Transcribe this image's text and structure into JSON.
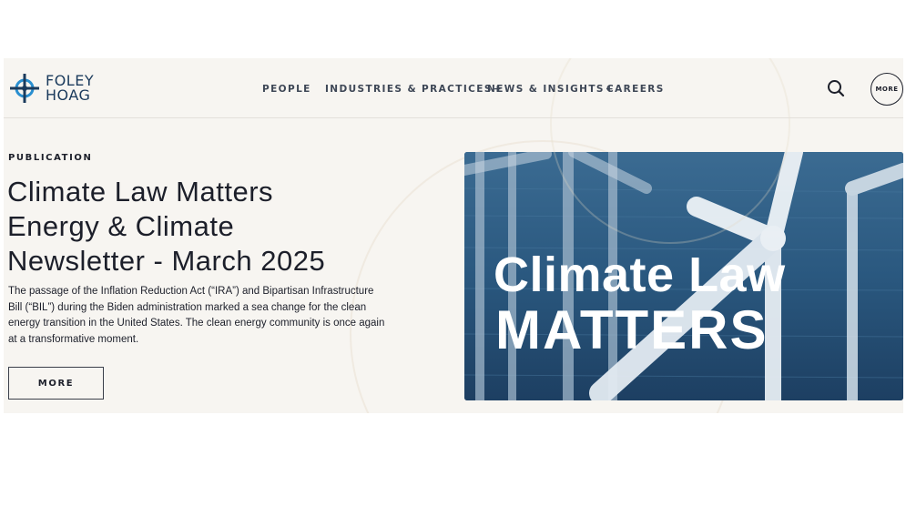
{
  "brand": {
    "line1": "FOLEY",
    "line2": "HOAG"
  },
  "nav": {
    "items": [
      {
        "label": "PEOPLE",
        "plus": ""
      },
      {
        "label": "INDUSTRIES & PRACTICES",
        "plus": "+"
      },
      {
        "label": "NEWS & INSIGHTS",
        "plus": "+"
      },
      {
        "label": "CAREERS",
        "plus": ""
      }
    ],
    "more_label": "MORE",
    "search_icon": "search-icon"
  },
  "article": {
    "eyebrow": "PUBLICATION",
    "title_lines": [
      "Climate Law Matters",
      "Energy & Climate",
      "Newsletter - March 2025"
    ],
    "summary": "The passage of the Inflation Reduction Act (“IRA”) and Bipartisan Infrastructure Bill (“BIL”) during the Biden administration marked a sea change for the clean energy transition in the United States. The clean energy community is once again at a transformative moment.",
    "cta_label": "MORE"
  },
  "hero": {
    "line1": "Climate Law",
    "line2": "MATTERS"
  },
  "colors": {
    "background": "#f7f5f1",
    "text": "#1c1f2a",
    "brand_blue": "#1a3a5c",
    "logo_blue": "#2a8fd0",
    "nav_text": "#3e4756"
  }
}
